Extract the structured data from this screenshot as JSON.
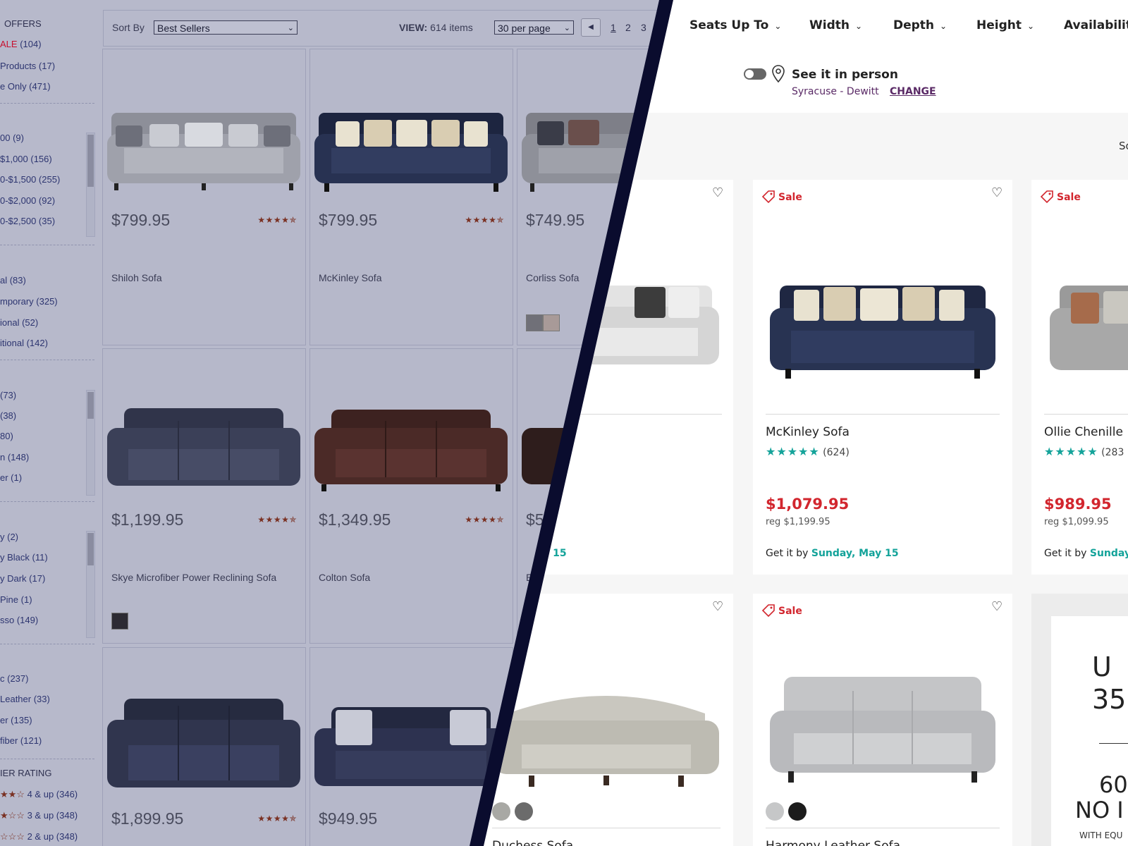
{
  "old_site": {
    "sidebar": {
      "offers_heading": "OFFERS",
      "offer_items": [
        {
          "label_red": "ALE",
          "label": " (104)"
        },
        {
          "label": "Products (17)"
        },
        {
          "label": "e Only (471)"
        }
      ],
      "price_items": [
        "00 (9)",
        "$1,000 (156)",
        "0-$1,500 (255)",
        "0-$2,000 (92)",
        "0-$2,500 (35)"
      ],
      "style_items": [
        "al (83)",
        "mporary (325)",
        "ional (52)",
        "itional (142)"
      ],
      "type_items": [
        "(73)",
        "(38)",
        "80)",
        "n (148)",
        "er (1)"
      ],
      "color_items": [
        "y (2)",
        "y Black (11)",
        "y Dark (17)",
        "Pine (1)",
        "sso (149)"
      ],
      "material_items": [
        "c (237)",
        "Leather (33)",
        "er (135)",
        "fiber (121)"
      ],
      "rating_heading": "IER RATING",
      "rating_items": [
        {
          "stars": "★★☆",
          "label": "4 & up (346)"
        },
        {
          "stars": "★☆☆",
          "label": "3 & up (348)"
        },
        {
          "stars": "☆☆☆",
          "label": "2 & up (348)"
        }
      ]
    },
    "toolbar": {
      "sort_label": "Sort By",
      "sort_value": "Best Sellers",
      "view_label": "VIEW:",
      "view_value": "614 items",
      "per_page": "30 per page",
      "prev_icon": "◀",
      "pages": [
        "1",
        "2",
        "3"
      ]
    },
    "products": [
      {
        "price": "$799.95",
        "stars": "★★★★✯",
        "name": "Shiloh Sofa"
      },
      {
        "price": "$799.95",
        "stars": "★★★★✯",
        "name": "McKinley Sofa"
      },
      {
        "price": "$749.95",
        "stars": "",
        "name": "Corliss Sofa"
      },
      {
        "price": "$1,199.95",
        "stars": "★★★★✯",
        "name": "Skye Microfiber Power Reclining Sofa"
      },
      {
        "price": "$1,349.95",
        "stars": "★★★★✯",
        "name": "Colton Sofa"
      },
      {
        "price": "$5",
        "stars": "",
        "name": "E"
      },
      {
        "price": "$1,899.95",
        "stars": "★★★★✯",
        "name": ""
      },
      {
        "price": "$949.95",
        "stars": "★★",
        "name": ""
      }
    ]
  },
  "new_site": {
    "filters": [
      "Seats Up To",
      "Width",
      "Depth",
      "Height",
      "Availability"
    ],
    "see_in_person": {
      "title": "See it in person",
      "store": "Syracuse - Dewitt",
      "change": "CHANGE"
    },
    "sort_cut": "So",
    "products": [
      {
        "sale": "",
        "name": "",
        "reviews": "",
        "price": "",
        "reg": "",
        "getit": "",
        "day": "nday, May 15"
      },
      {
        "sale": "Sale",
        "name": "McKinley Sofa",
        "reviews": "(624)",
        "price": "$1,079.95",
        "reg": "reg $1,199.95",
        "getit": "Get it by",
        "day": "Sunday, May 15"
      },
      {
        "sale": "Sale",
        "name": "Ollie Chenille",
        "reviews": "(283",
        "price": "$989.95",
        "reg": "reg $1,099.95",
        "getit": "Get it by",
        "day": "Sunday"
      },
      {
        "sale": "",
        "name": "Duchess Sofa",
        "reviews": "",
        "price": "",
        "reg": "",
        "getit": "",
        "day": ""
      },
      {
        "sale": "Sale",
        "name": "Harmony Leather Sofa",
        "reviews": "",
        "price": "",
        "reg": "",
        "getit": "",
        "day": ""
      }
    ],
    "promo": {
      "line1": "U",
      "line2": "35",
      "line3": "60",
      "line4": "NO I",
      "line5": "WITH EQU"
    },
    "review_stars": "★★★★★",
    "colors": {
      "sale_red": "#d2262e",
      "teal": "#14a39a",
      "divider_navy": "#0a0c2e"
    }
  }
}
